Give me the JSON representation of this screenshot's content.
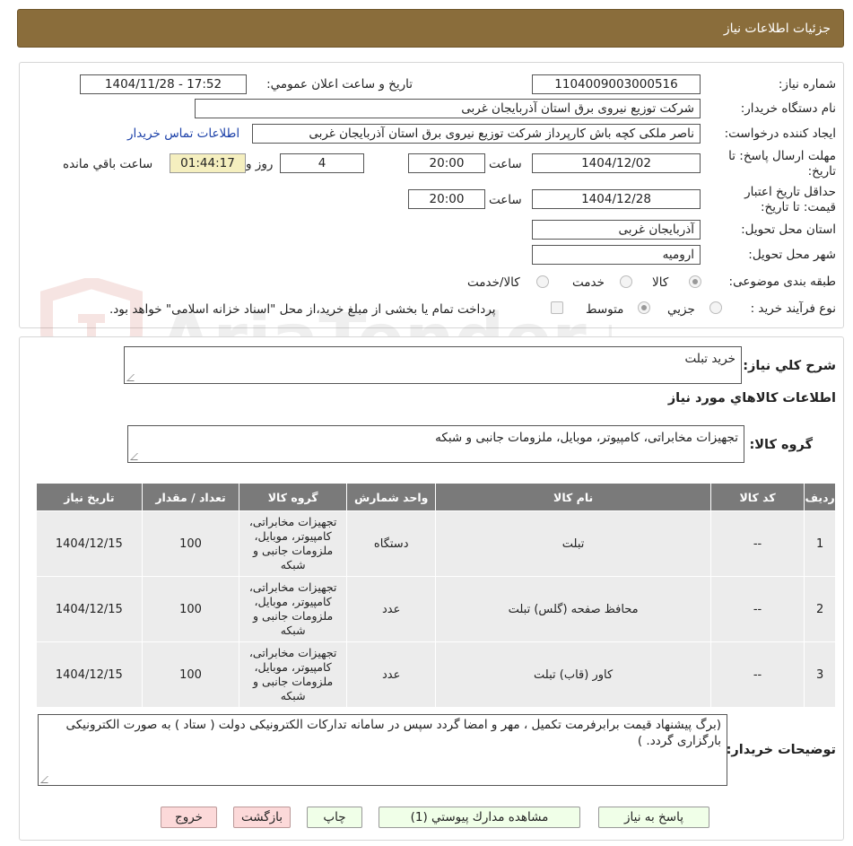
{
  "header": {
    "title": "جزئيات اطلاعات نياز"
  },
  "watermark": {
    "text": "AriaTender.neT"
  },
  "form": {
    "need_number_label": "شماره نياز:",
    "need_number": "1104009003000516",
    "announce_label": "تاريخ و ساعت اعلان عمومي:",
    "announce_value": "1404/11/28 - 17:52",
    "buyer_org_label": "نام دستگاه خريدار:",
    "buyer_org": "شرکت توزیع نیروی برق استان آذربایجان غربی",
    "creator_label": "ايجاد کننده درخواست:",
    "creator": "ناصر ملکی کچه باش کارپرداز شرکت توزیع نیروی برق استان آذربایجان غربی",
    "contact_link": "اطلاعات تماس خريدار",
    "send_deadline_label": "مهلت ارسال پاسخ: تا تاريخ:",
    "send_deadline_date": "1404/12/02",
    "time_label": "ساعت",
    "send_deadline_time": "20:00",
    "days_value": "4",
    "days_label": "روز و",
    "remaining_time": "01:44:17",
    "remaining_label": "ساعت باقي مانده",
    "price_validity_label": "حداقل تاريخ اعتبار قيمت: تا تاريخ:",
    "price_validity_date": "1404/12/28",
    "price_validity_time": "20:00",
    "province_label": "استان محل تحويل:",
    "province": "آذربایجان غربی",
    "city_label": "شهر محل تحويل:",
    "city": "ارومیه",
    "category_label": "طبقه بندی موضوعی:",
    "category_options": [
      "کالا",
      "خدمت",
      "کالا/خدمت"
    ],
    "process_label": "نوع فرآيند خريد :",
    "process_options": [
      "جزيي",
      "متوسط"
    ],
    "payment_note": "پرداخت تمام يا بخشی از مبلغ خريد،از محل \"اسناد خزانه اسلامی\" خواهد بود."
  },
  "details": {
    "general_desc_label": "شرح كلي نياز:",
    "general_desc": "خرید تبلت",
    "goods_info_title": "اطلاعات کالاهاي مورد نياز",
    "goods_group_label": "گروه کالا:",
    "goods_group": "تجهیزات مخابراتی، کامپیوتر، موبایل، ملزومات جانبی و شبکه",
    "table": {
      "headers": [
        "رديف",
        "کد کالا",
        "نام کالا",
        "واحد شمارش",
        "گروه کالا",
        "تعداد / مقدار",
        "تاريخ نياز"
      ],
      "rows": [
        [
          "1",
          "--",
          "تبلت",
          "دستگاه",
          "تجهیزات مخابراتی، کامپیوتر، موبایل، ملزومات جانبی و شبکه",
          "100",
          "1404/12/15"
        ],
        [
          "2",
          "--",
          "محافظ صفحه (گلس) تبلت",
          "عدد",
          "تجهیزات مخابراتی، کامپیوتر، موبایل، ملزومات جانبی و شبکه",
          "100",
          "1404/12/15"
        ],
        [
          "3",
          "--",
          "کاور (قاب) تبلت",
          "عدد",
          "تجهیزات مخابراتی، کامپیوتر، موبایل، ملزومات جانبی و شبکه",
          "100",
          "1404/12/15"
        ]
      ]
    },
    "buyer_notes_label": "توضيحات خريدار:",
    "buyer_notes": "(برگ پیشنهاد قیمت برابرفرمت تکمیل ، مهر و امضا گردد سپس در سامانه تدارکات الکترونیکی دولت ( ستاد ) به صورت الکترونیکی  بارگزاری گردد. )"
  },
  "buttons": {
    "reply": "پاسخ به نياز",
    "attachments": "مشاهده مدارك پيوستي (1)",
    "print": "چاپ",
    "back": "بازگشت",
    "exit": "خروج"
  }
}
